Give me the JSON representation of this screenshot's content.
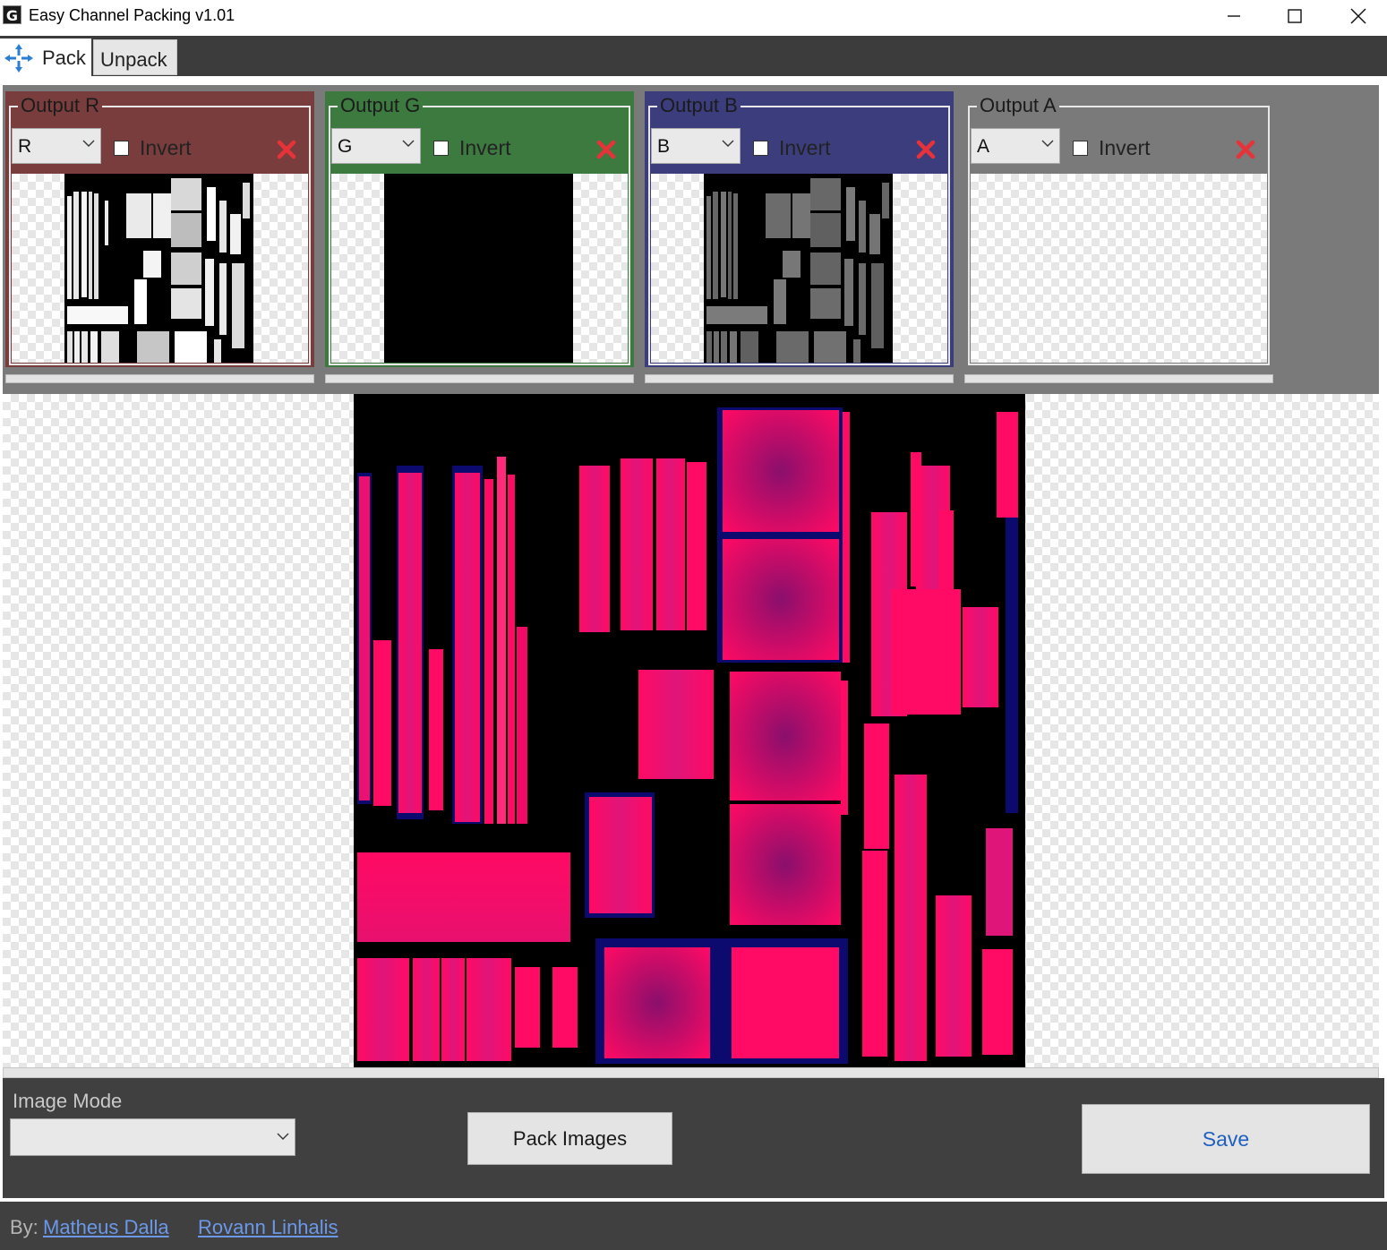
{
  "window": {
    "app_icon_glyph": "G",
    "title": "Easy Channel Packing v1.01"
  },
  "tabs": [
    {
      "label": "Pack",
      "icon": "pack-arrows-icon",
      "selected": true
    },
    {
      "label": "Unpack",
      "selected": false
    }
  ],
  "channels": [
    {
      "legend": "Output R",
      "channel": "R",
      "invert_label": "Invert",
      "invert_checked": false,
      "color": "#7a3d3d",
      "preview": "grayscale channel texture (white on black)"
    },
    {
      "legend": "Output G",
      "channel": "G",
      "invert_label": "Invert",
      "invert_checked": false,
      "color": "#3d7a40",
      "preview": "solid black channel"
    },
    {
      "legend": "Output B",
      "channel": "B",
      "invert_label": "Invert",
      "invert_checked": false,
      "color": "#3b3d7c",
      "preview": "grayscale channel texture (gray on black)"
    },
    {
      "legend": "Output A",
      "channel": "A",
      "invert_label": "Invert",
      "invert_checked": false,
      "color": "#7a7a7a",
      "preview": "empty"
    }
  ],
  "image_mode": {
    "label": "Image Mode",
    "value": ""
  },
  "buttons": {
    "pack": "Pack Images",
    "save": "Save"
  },
  "footer": {
    "by_label": "By:",
    "authors": [
      "Matheus Dalla",
      "Rovann Linhalis"
    ]
  },
  "colors": {
    "panel_bg": "#7a7a7a",
    "dark_bg": "#404040",
    "tabstrip_bg": "#3c3c3c",
    "packed_pink": "#ff0a64",
    "packed_navy": "#0c0a6e",
    "link": "#6b98e8"
  }
}
